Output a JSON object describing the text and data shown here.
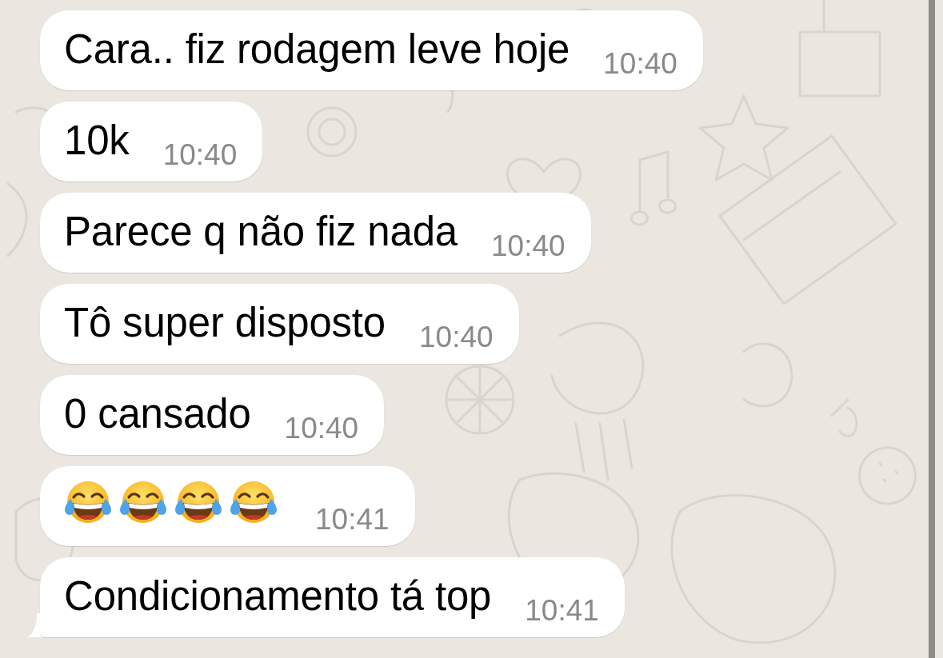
{
  "messages": [
    {
      "kind": "text",
      "text": "Cara.. fiz rodagem leve hoje",
      "time": "10:40",
      "tail": false
    },
    {
      "kind": "text",
      "text": "10k",
      "time": "10:40",
      "tail": false
    },
    {
      "kind": "text",
      "text": "Parece q não fiz nada",
      "time": "10:40",
      "tail": false
    },
    {
      "kind": "text",
      "text": "Tô super disposto",
      "time": "10:40",
      "tail": false
    },
    {
      "kind": "text",
      "text": "0 cansado",
      "time": "10:40",
      "tail": false
    },
    {
      "kind": "emoji",
      "emojis": [
        {
          "kind": "tears-of-joy"
        },
        {
          "kind": "tears-of-joy"
        },
        {
          "kind": "tears-of-joy"
        },
        {
          "kind": "tears-of-joy"
        }
      ],
      "time": "10:41",
      "tail": false
    },
    {
      "kind": "text",
      "text": "Condicionamento tá top",
      "time": "10:41",
      "tail": true
    }
  ]
}
